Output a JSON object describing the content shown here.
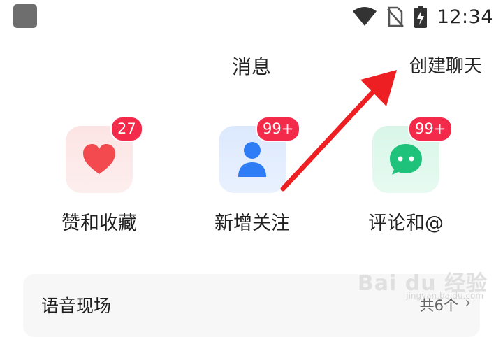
{
  "status_bar": {
    "time": "12:34",
    "icons": [
      "app-square-icon",
      "wifi-icon",
      "no-sim-icon",
      "battery-charging-icon"
    ]
  },
  "header": {
    "title": "消息",
    "create_chat_label": "创建聊天"
  },
  "categories": [
    {
      "label": "赞和收藏",
      "badge": "27",
      "icon": "heart-icon",
      "color": "#f24a4f"
    },
    {
      "label": "新增关注",
      "badge": "99+",
      "icon": "person-icon",
      "color": "#2e7cf6"
    },
    {
      "label": "评论和@",
      "badge": "99+",
      "icon": "chat-bubble-icon",
      "color": "#1ec27a"
    }
  ],
  "voice_section": {
    "title": "语音现场",
    "count": "共6个"
  },
  "watermark": {
    "text": "Bai du 经验",
    "sub": "jingyan.baidu.com"
  },
  "colors": {
    "badge": "#f32a4a",
    "arrow": "#ee1f22"
  }
}
